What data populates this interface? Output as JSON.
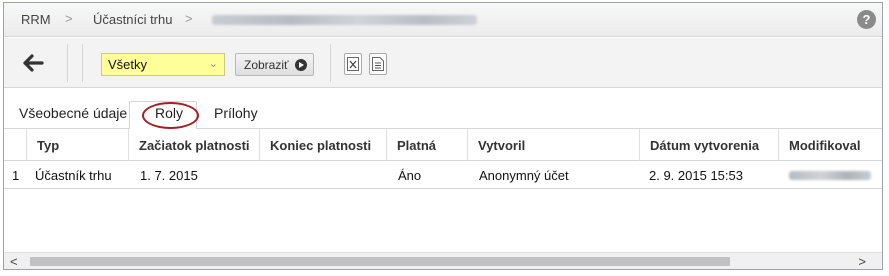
{
  "breadcrumb": {
    "root": "RRM",
    "section": "Účastníci trhu",
    "separator": ">"
  },
  "help_icon_text": "?",
  "toolbar": {
    "filter_value": "Všetky",
    "show_label": "Zobraziť"
  },
  "tabs": [
    {
      "label": "Všeobecné údaje"
    },
    {
      "label": "Roly"
    },
    {
      "label": "Prílohy"
    }
  ],
  "active_tab": "Roly",
  "table": {
    "columns": [
      "Typ",
      "Začiatok platnosti",
      "Koniec platnosti",
      "Platná",
      "Vytvoril",
      "Dátum vytvorenia",
      "Modifikoval"
    ],
    "rows": [
      {
        "num": "1",
        "typ": "Účastník trhu",
        "zaciatok": "1. 7. 2015",
        "koniec": "",
        "platna": "Áno",
        "vytvoril": "Anonymný účet",
        "datum": "2. 9. 2015 15:53"
      }
    ]
  },
  "scrollbar": {
    "left_arrow": "<",
    "right_arrow": ">"
  }
}
